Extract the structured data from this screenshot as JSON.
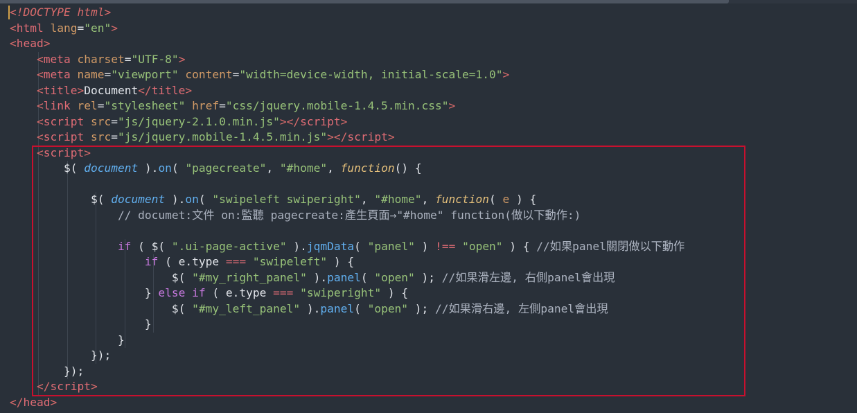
{
  "editor": {
    "language": "html",
    "colors": {
      "background": "#293039",
      "tag": "#e06c75",
      "attribute": "#d19a66",
      "string": "#98c379",
      "keyword": "#c678dd",
      "function": "#61afef",
      "comment": "#abb2bf",
      "highlight_box": "#c8102e",
      "cursor": "#d4a24a"
    },
    "highlight": {
      "label": "red-annotation-box",
      "from_line": 10,
      "to_line": 25
    },
    "lines": [
      [
        {
          "c": "t-angle",
          "t": "<"
        },
        {
          "c": "t-doctype",
          "t": "!DOCTYPE html"
        },
        {
          "c": "t-angle",
          "t": ">"
        }
      ],
      [
        {
          "c": "t-angle",
          "t": "<"
        },
        {
          "c": "t-tag",
          "t": "html"
        },
        {
          "c": "t-punc",
          "t": " "
        },
        {
          "c": "t-attr",
          "t": "lang"
        },
        {
          "c": "t-punc",
          "t": "="
        },
        {
          "c": "t-str",
          "t": "\"en\""
        },
        {
          "c": "t-angle",
          "t": ">"
        }
      ],
      [
        {
          "c": "t-angle",
          "t": "<"
        },
        {
          "c": "t-tag",
          "t": "head"
        },
        {
          "c": "t-angle",
          "t": ">"
        }
      ],
      [
        {
          "c": "t-punc",
          "t": "    "
        },
        {
          "c": "t-angle",
          "t": "<"
        },
        {
          "c": "t-tag",
          "t": "meta"
        },
        {
          "c": "t-punc",
          "t": " "
        },
        {
          "c": "t-attr",
          "t": "charset"
        },
        {
          "c": "t-punc",
          "t": "="
        },
        {
          "c": "t-str",
          "t": "\"UTF-8\""
        },
        {
          "c": "t-angle",
          "t": ">"
        }
      ],
      [
        {
          "c": "t-punc",
          "t": "    "
        },
        {
          "c": "t-angle",
          "t": "<"
        },
        {
          "c": "t-tag",
          "t": "meta"
        },
        {
          "c": "t-punc",
          "t": " "
        },
        {
          "c": "t-attr",
          "t": "name"
        },
        {
          "c": "t-punc",
          "t": "="
        },
        {
          "c": "t-str",
          "t": "\"viewport\""
        },
        {
          "c": "t-punc",
          "t": " "
        },
        {
          "c": "t-attr",
          "t": "content"
        },
        {
          "c": "t-punc",
          "t": "="
        },
        {
          "c": "t-str",
          "t": "\"width=device-width, initial-scale=1.0\""
        },
        {
          "c": "t-angle",
          "t": ">"
        }
      ],
      [
        {
          "c": "t-punc",
          "t": "    "
        },
        {
          "c": "t-angle",
          "t": "<"
        },
        {
          "c": "t-tag",
          "t": "title"
        },
        {
          "c": "t-angle",
          "t": ">"
        },
        {
          "c": "t-punc",
          "t": "Document"
        },
        {
          "c": "t-angle",
          "t": "</"
        },
        {
          "c": "t-tag",
          "t": "title"
        },
        {
          "c": "t-angle",
          "t": ">"
        }
      ],
      [
        {
          "c": "t-punc",
          "t": "    "
        },
        {
          "c": "t-angle",
          "t": "<"
        },
        {
          "c": "t-tag",
          "t": "link"
        },
        {
          "c": "t-punc",
          "t": " "
        },
        {
          "c": "t-attr",
          "t": "rel"
        },
        {
          "c": "t-punc",
          "t": "="
        },
        {
          "c": "t-str",
          "t": "\"stylesheet\""
        },
        {
          "c": "t-punc",
          "t": " "
        },
        {
          "c": "t-attr",
          "t": "href"
        },
        {
          "c": "t-punc",
          "t": "="
        },
        {
          "c": "t-str",
          "t": "\"css/jquery.mobile-1.4.5.min.css\""
        },
        {
          "c": "t-angle",
          "t": ">"
        }
      ],
      [
        {
          "c": "t-punc",
          "t": "    "
        },
        {
          "c": "t-angle",
          "t": "<"
        },
        {
          "c": "t-tag",
          "t": "script"
        },
        {
          "c": "t-punc",
          "t": " "
        },
        {
          "c": "t-attr",
          "t": "src"
        },
        {
          "c": "t-punc",
          "t": "="
        },
        {
          "c": "t-str",
          "t": "\"js/jquery-2.1.0.min.js\""
        },
        {
          "c": "t-angle",
          "t": "></"
        },
        {
          "c": "t-tag",
          "t": "script"
        },
        {
          "c": "t-angle",
          "t": ">"
        }
      ],
      [
        {
          "c": "t-punc",
          "t": "    "
        },
        {
          "c": "t-angle",
          "t": "<"
        },
        {
          "c": "t-tag",
          "t": "script"
        },
        {
          "c": "t-punc",
          "t": " "
        },
        {
          "c": "t-attr",
          "t": "src"
        },
        {
          "c": "t-punc",
          "t": "="
        },
        {
          "c": "t-str",
          "t": "\"js/jquery.mobile-1.4.5.min.js\""
        },
        {
          "c": "t-angle",
          "t": "></"
        },
        {
          "c": "t-tag",
          "t": "script"
        },
        {
          "c": "t-angle",
          "t": ">"
        }
      ],
      [
        {
          "c": "t-punc",
          "t": "    "
        },
        {
          "c": "t-angle",
          "t": "<"
        },
        {
          "c": "t-tag",
          "t": "script"
        },
        {
          "c": "t-angle",
          "t": ">"
        }
      ],
      [
        {
          "c": "t-punc",
          "t": "        "
        },
        {
          "c": "t-punc",
          "t": "$( "
        },
        {
          "c": "t-obj",
          "t": "document"
        },
        {
          "c": "t-punc",
          "t": " )."
        },
        {
          "c": "t-func",
          "t": "on"
        },
        {
          "c": "t-punc",
          "t": "( "
        },
        {
          "c": "t-str",
          "t": "\"pagecreate\""
        },
        {
          "c": "t-punc",
          "t": ", "
        },
        {
          "c": "t-str",
          "t": "\"#home\""
        },
        {
          "c": "t-punc",
          "t": ", "
        },
        {
          "c": "t-fn",
          "t": "function"
        },
        {
          "c": "t-punc",
          "t": "() {"
        }
      ],
      [],
      [
        {
          "c": "t-punc",
          "t": "            "
        },
        {
          "c": "t-punc",
          "t": "$( "
        },
        {
          "c": "t-obj",
          "t": "document"
        },
        {
          "c": "t-punc",
          "t": " )."
        },
        {
          "c": "t-func",
          "t": "on"
        },
        {
          "c": "t-punc",
          "t": "( "
        },
        {
          "c": "t-str",
          "t": "\"swipeleft swiperight\""
        },
        {
          "c": "t-punc",
          "t": ", "
        },
        {
          "c": "t-str",
          "t": "\"#home\""
        },
        {
          "c": "t-punc",
          "t": ", "
        },
        {
          "c": "t-fn",
          "t": "function"
        },
        {
          "c": "t-punc",
          "t": "( "
        },
        {
          "c": "t-param",
          "t": "e"
        },
        {
          "c": "t-punc",
          "t": " ) {"
        }
      ],
      [
        {
          "c": "t-punc",
          "t": "                "
        },
        {
          "c": "t-cmt",
          "t": "// documet:文件 on:監聽 pagecreate:產生頁面→\"#home\" function(做以下動作:)"
        }
      ],
      [],
      [
        {
          "c": "t-punc",
          "t": "                "
        },
        {
          "c": "t-kw",
          "t": "if"
        },
        {
          "c": "t-punc",
          "t": " ( $( "
        },
        {
          "c": "t-str",
          "t": "\".ui-page-active\""
        },
        {
          "c": "t-punc",
          "t": " )."
        },
        {
          "c": "t-func",
          "t": "jqmData"
        },
        {
          "c": "t-punc",
          "t": "( "
        },
        {
          "c": "t-str",
          "t": "\"panel\""
        },
        {
          "c": "t-punc",
          "t": " ) "
        },
        {
          "c": "t-op",
          "t": "!=="
        },
        {
          "c": "t-punc",
          "t": " "
        },
        {
          "c": "t-str",
          "t": "\"open\""
        },
        {
          "c": "t-punc",
          "t": " ) { "
        },
        {
          "c": "t-cmt",
          "t": "//如果panel關閉做以下動作"
        }
      ],
      [
        {
          "c": "t-punc",
          "t": "                    "
        },
        {
          "c": "t-kw",
          "t": "if"
        },
        {
          "c": "t-punc",
          "t": " ( e.type "
        },
        {
          "c": "t-op",
          "t": "==="
        },
        {
          "c": "t-punc",
          "t": " "
        },
        {
          "c": "t-str",
          "t": "\"swipeleft\""
        },
        {
          "c": "t-punc",
          "t": " ) {"
        }
      ],
      [
        {
          "c": "t-punc",
          "t": "                        "
        },
        {
          "c": "t-punc",
          "t": "$( "
        },
        {
          "c": "t-str",
          "t": "\"#my_right_panel\""
        },
        {
          "c": "t-punc",
          "t": " )."
        },
        {
          "c": "t-func",
          "t": "panel"
        },
        {
          "c": "t-punc",
          "t": "( "
        },
        {
          "c": "t-str",
          "t": "\"open\""
        },
        {
          "c": "t-punc",
          "t": " ); "
        },
        {
          "c": "t-cmt",
          "t": "//如果滑左邊, 右側panel會出現"
        }
      ],
      [
        {
          "c": "t-punc",
          "t": "                    "
        },
        {
          "c": "t-punc",
          "t": "} "
        },
        {
          "c": "t-kw",
          "t": "else if"
        },
        {
          "c": "t-punc",
          "t": " ( e.type "
        },
        {
          "c": "t-op",
          "t": "==="
        },
        {
          "c": "t-punc",
          "t": " "
        },
        {
          "c": "t-str",
          "t": "\"swiperight\""
        },
        {
          "c": "t-punc",
          "t": " ) {"
        }
      ],
      [
        {
          "c": "t-punc",
          "t": "                        "
        },
        {
          "c": "t-punc",
          "t": "$( "
        },
        {
          "c": "t-str",
          "t": "\"#my_left_panel\""
        },
        {
          "c": "t-punc",
          "t": " )."
        },
        {
          "c": "t-func",
          "t": "panel"
        },
        {
          "c": "t-punc",
          "t": "( "
        },
        {
          "c": "t-str",
          "t": "\"open\""
        },
        {
          "c": "t-punc",
          "t": " ); "
        },
        {
          "c": "t-cmt",
          "t": "//如果滑右邊, 左側panel會出現"
        }
      ],
      [
        {
          "c": "t-punc",
          "t": "                    "
        },
        {
          "c": "t-punc",
          "t": "}"
        }
      ],
      [
        {
          "c": "t-punc",
          "t": "                "
        },
        {
          "c": "t-punc",
          "t": "}"
        }
      ],
      [
        {
          "c": "t-punc",
          "t": "            "
        },
        {
          "c": "t-punc",
          "t": "});"
        }
      ],
      [
        {
          "c": "t-punc",
          "t": "        "
        },
        {
          "c": "t-punc",
          "t": "});"
        }
      ],
      [
        {
          "c": "t-punc",
          "t": "    "
        },
        {
          "c": "t-angle",
          "t": "</"
        },
        {
          "c": "t-tag",
          "t": "script"
        },
        {
          "c": "t-angle",
          "t": ">"
        }
      ],
      [
        {
          "c": "t-angle",
          "t": "</"
        },
        {
          "c": "t-tag",
          "t": "head"
        },
        {
          "c": "t-angle",
          "t": ">"
        }
      ]
    ]
  }
}
